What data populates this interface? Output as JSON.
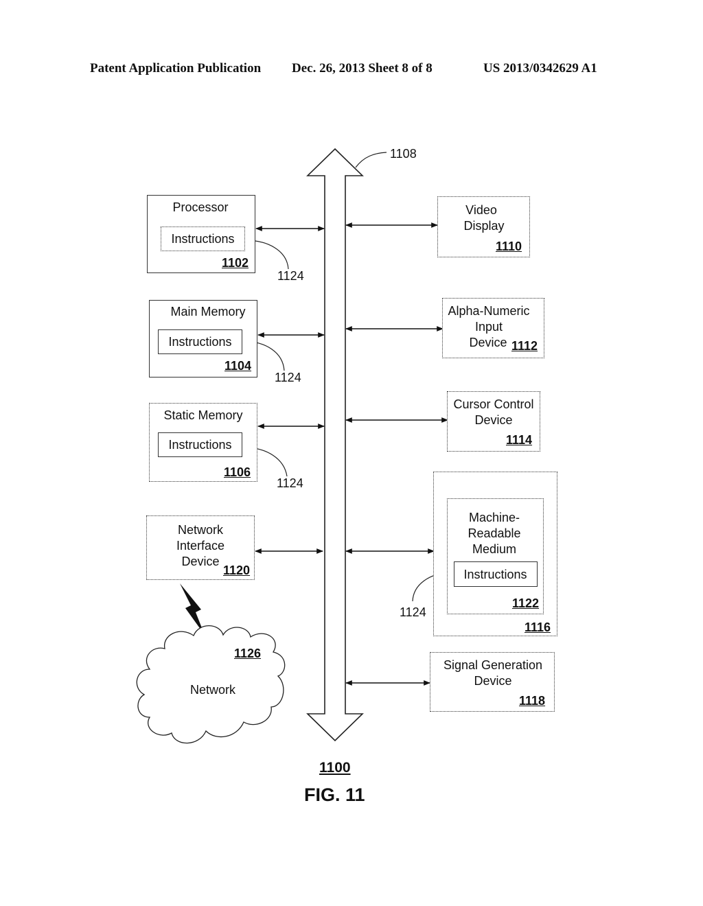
{
  "header": {
    "publication": "Patent Application Publication",
    "date_sheet": "Dec. 26, 2013   Sheet 8 of 8",
    "number": "US 2013/0342629 A1"
  },
  "figure": {
    "system_ref": "1100",
    "caption": "FIG. 11",
    "bus_ref": "1108",
    "instructions_ref": "1124"
  },
  "left_blocks": [
    {
      "title": "Processor",
      "inner": "Instructions",
      "ref": "1102"
    },
    {
      "title": "Main Memory",
      "inner": "Instructions",
      "ref": "1104"
    },
    {
      "title": "Static Memory",
      "inner": "Instructions",
      "ref": "1106"
    },
    {
      "title_lines": [
        "Network",
        "Interface",
        "Device"
      ],
      "ref": "1120"
    }
  ],
  "right_blocks": [
    {
      "title_lines": [
        "Video",
        "Display"
      ],
      "ref": "1110"
    },
    {
      "title_lines": [
        "Alpha-Numeric",
        "Input",
        "Device"
      ],
      "ref": "1112"
    },
    {
      "title_lines": [
        "Cursor Control",
        "Device"
      ],
      "ref": "1114"
    },
    {
      "outer_ref": "1116",
      "inner_title_lines": [
        "Machine-",
        "Readable",
        "Medium"
      ],
      "inner": "Instructions",
      "inner_ref": "1122"
    },
    {
      "title_lines": [
        "Signal Generation",
        "Device"
      ],
      "ref": "1118"
    }
  ],
  "network": {
    "label": "Network",
    "ref": "1126"
  }
}
